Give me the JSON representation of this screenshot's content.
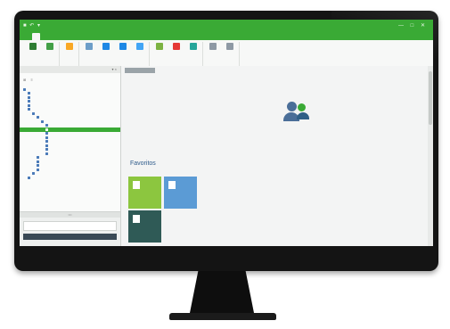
{
  "window": {
    "quick_access": "■ ↶ ▾",
    "title": "",
    "controls": "— □ ✕"
  },
  "ribbon_tabs": [
    "",
    "",
    "",
    "",
    "",
    "",
    "",
    "",
    "",
    ""
  ],
  "ribbon_groups": [
    {
      "name": "",
      "buttons": [
        {
          "label": "",
          "color": "#2e7d32"
        },
        {
          "label": "",
          "color": "#43a047"
        }
      ]
    },
    {
      "name": "",
      "buttons": [
        {
          "label": "",
          "color": "#f9a825"
        }
      ]
    },
    {
      "name": "",
      "buttons": [
        {
          "label": "",
          "color": "#6d9ec8"
        },
        {
          "label": "",
          "color": "#1e88e5"
        },
        {
          "label": "",
          "color": "#1e88e5"
        },
        {
          "label": "",
          "color": "#42a5f5"
        }
      ]
    },
    {
      "name": "",
      "buttons": [
        {
          "label": "",
          "color": "#7cb342"
        },
        {
          "label": "",
          "color": "#e53935"
        },
        {
          "label": "",
          "color": "#26a69a"
        }
      ]
    },
    {
      "name": "",
      "buttons": [
        {
          "label": "",
          "color": "#8e99a4"
        },
        {
          "label": "",
          "color": "#8e99a4"
        }
      ]
    }
  ],
  "sidebar": {
    "header": "",
    "pins": "▾ ×",
    "title": "",
    "tools": "⊞ ≡",
    "tree": [
      {
        "label": "",
        "depth": 0
      },
      {
        "label": "",
        "depth": 1
      },
      {
        "label": "",
        "depth": 1
      },
      {
        "label": "",
        "depth": 1
      },
      {
        "label": "",
        "depth": 1
      },
      {
        "label": "",
        "depth": 1
      },
      {
        "label": "",
        "depth": 2
      },
      {
        "label": "",
        "depth": 3
      },
      {
        "label": "",
        "depth": 4
      },
      {
        "label": "",
        "depth": 5
      },
      {
        "label": "",
        "depth": 5,
        "selected": true
      },
      {
        "label": "",
        "depth": 5
      },
      {
        "label": "",
        "depth": 5
      },
      {
        "label": "",
        "depth": 5
      },
      {
        "label": "",
        "depth": 5
      },
      {
        "label": "",
        "depth": 5
      },
      {
        "label": "",
        "depth": 5
      },
      {
        "label": "",
        "depth": 3
      },
      {
        "label": "",
        "depth": 3
      },
      {
        "label": "",
        "depth": 3
      },
      {
        "label": "",
        "depth": 3
      },
      {
        "label": "",
        "depth": 2
      },
      {
        "label": "",
        "depth": 1
      }
    ],
    "grip": "•••",
    "nav_label": "",
    "accent_color": "#3aaa35"
  },
  "main": {
    "doc_tab": "",
    "brand_name": "",
    "description_line1": "",
    "description_line2": "",
    "favorites_title": "Favoritos",
    "tiles": [
      {
        "label": "",
        "color": "#8cc63f",
        "icon": "document-icon"
      },
      {
        "label": "",
        "color": "#5b9bd5",
        "icon": "calendar-icon"
      },
      {
        "label": "",
        "color": "#2f5a56",
        "icon": "list-icon"
      }
    ]
  },
  "theme": {
    "primary": "#3aaa35",
    "secondary": "#2f5f86"
  }
}
